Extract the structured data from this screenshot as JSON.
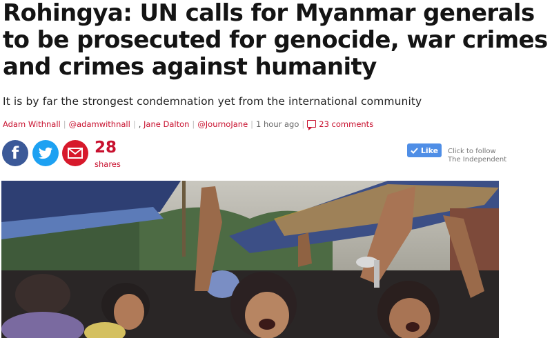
{
  "article": {
    "headline": "Rohingya: UN calls for Myanmar generals to be prosecuted for genocide, war crimes and crimes against humanity",
    "standfirst": "It is by far the strongest condemnation yet from the international community",
    "byline": {
      "author1": "Adam Withnall",
      "handle1": "@adamwithnall",
      "comma": ",",
      "author2": "Jane Dalton",
      "handle2": "@JournoJane",
      "time": "1 hour ago",
      "comments": "23 comments"
    }
  },
  "share": {
    "count": "28",
    "label": "shares",
    "buttons": [
      "facebook-icon",
      "twitter-icon",
      "email-icon"
    ]
  },
  "follow": {
    "like_label": "Like",
    "line1": "Click to follow",
    "line2": "The Independent"
  },
  "colors": {
    "accent_red": "#c8102e",
    "facebook": "#3b5998",
    "twitter": "#1da1f2",
    "email": "#d7192b",
    "like_blue": "#4f8ee6"
  }
}
